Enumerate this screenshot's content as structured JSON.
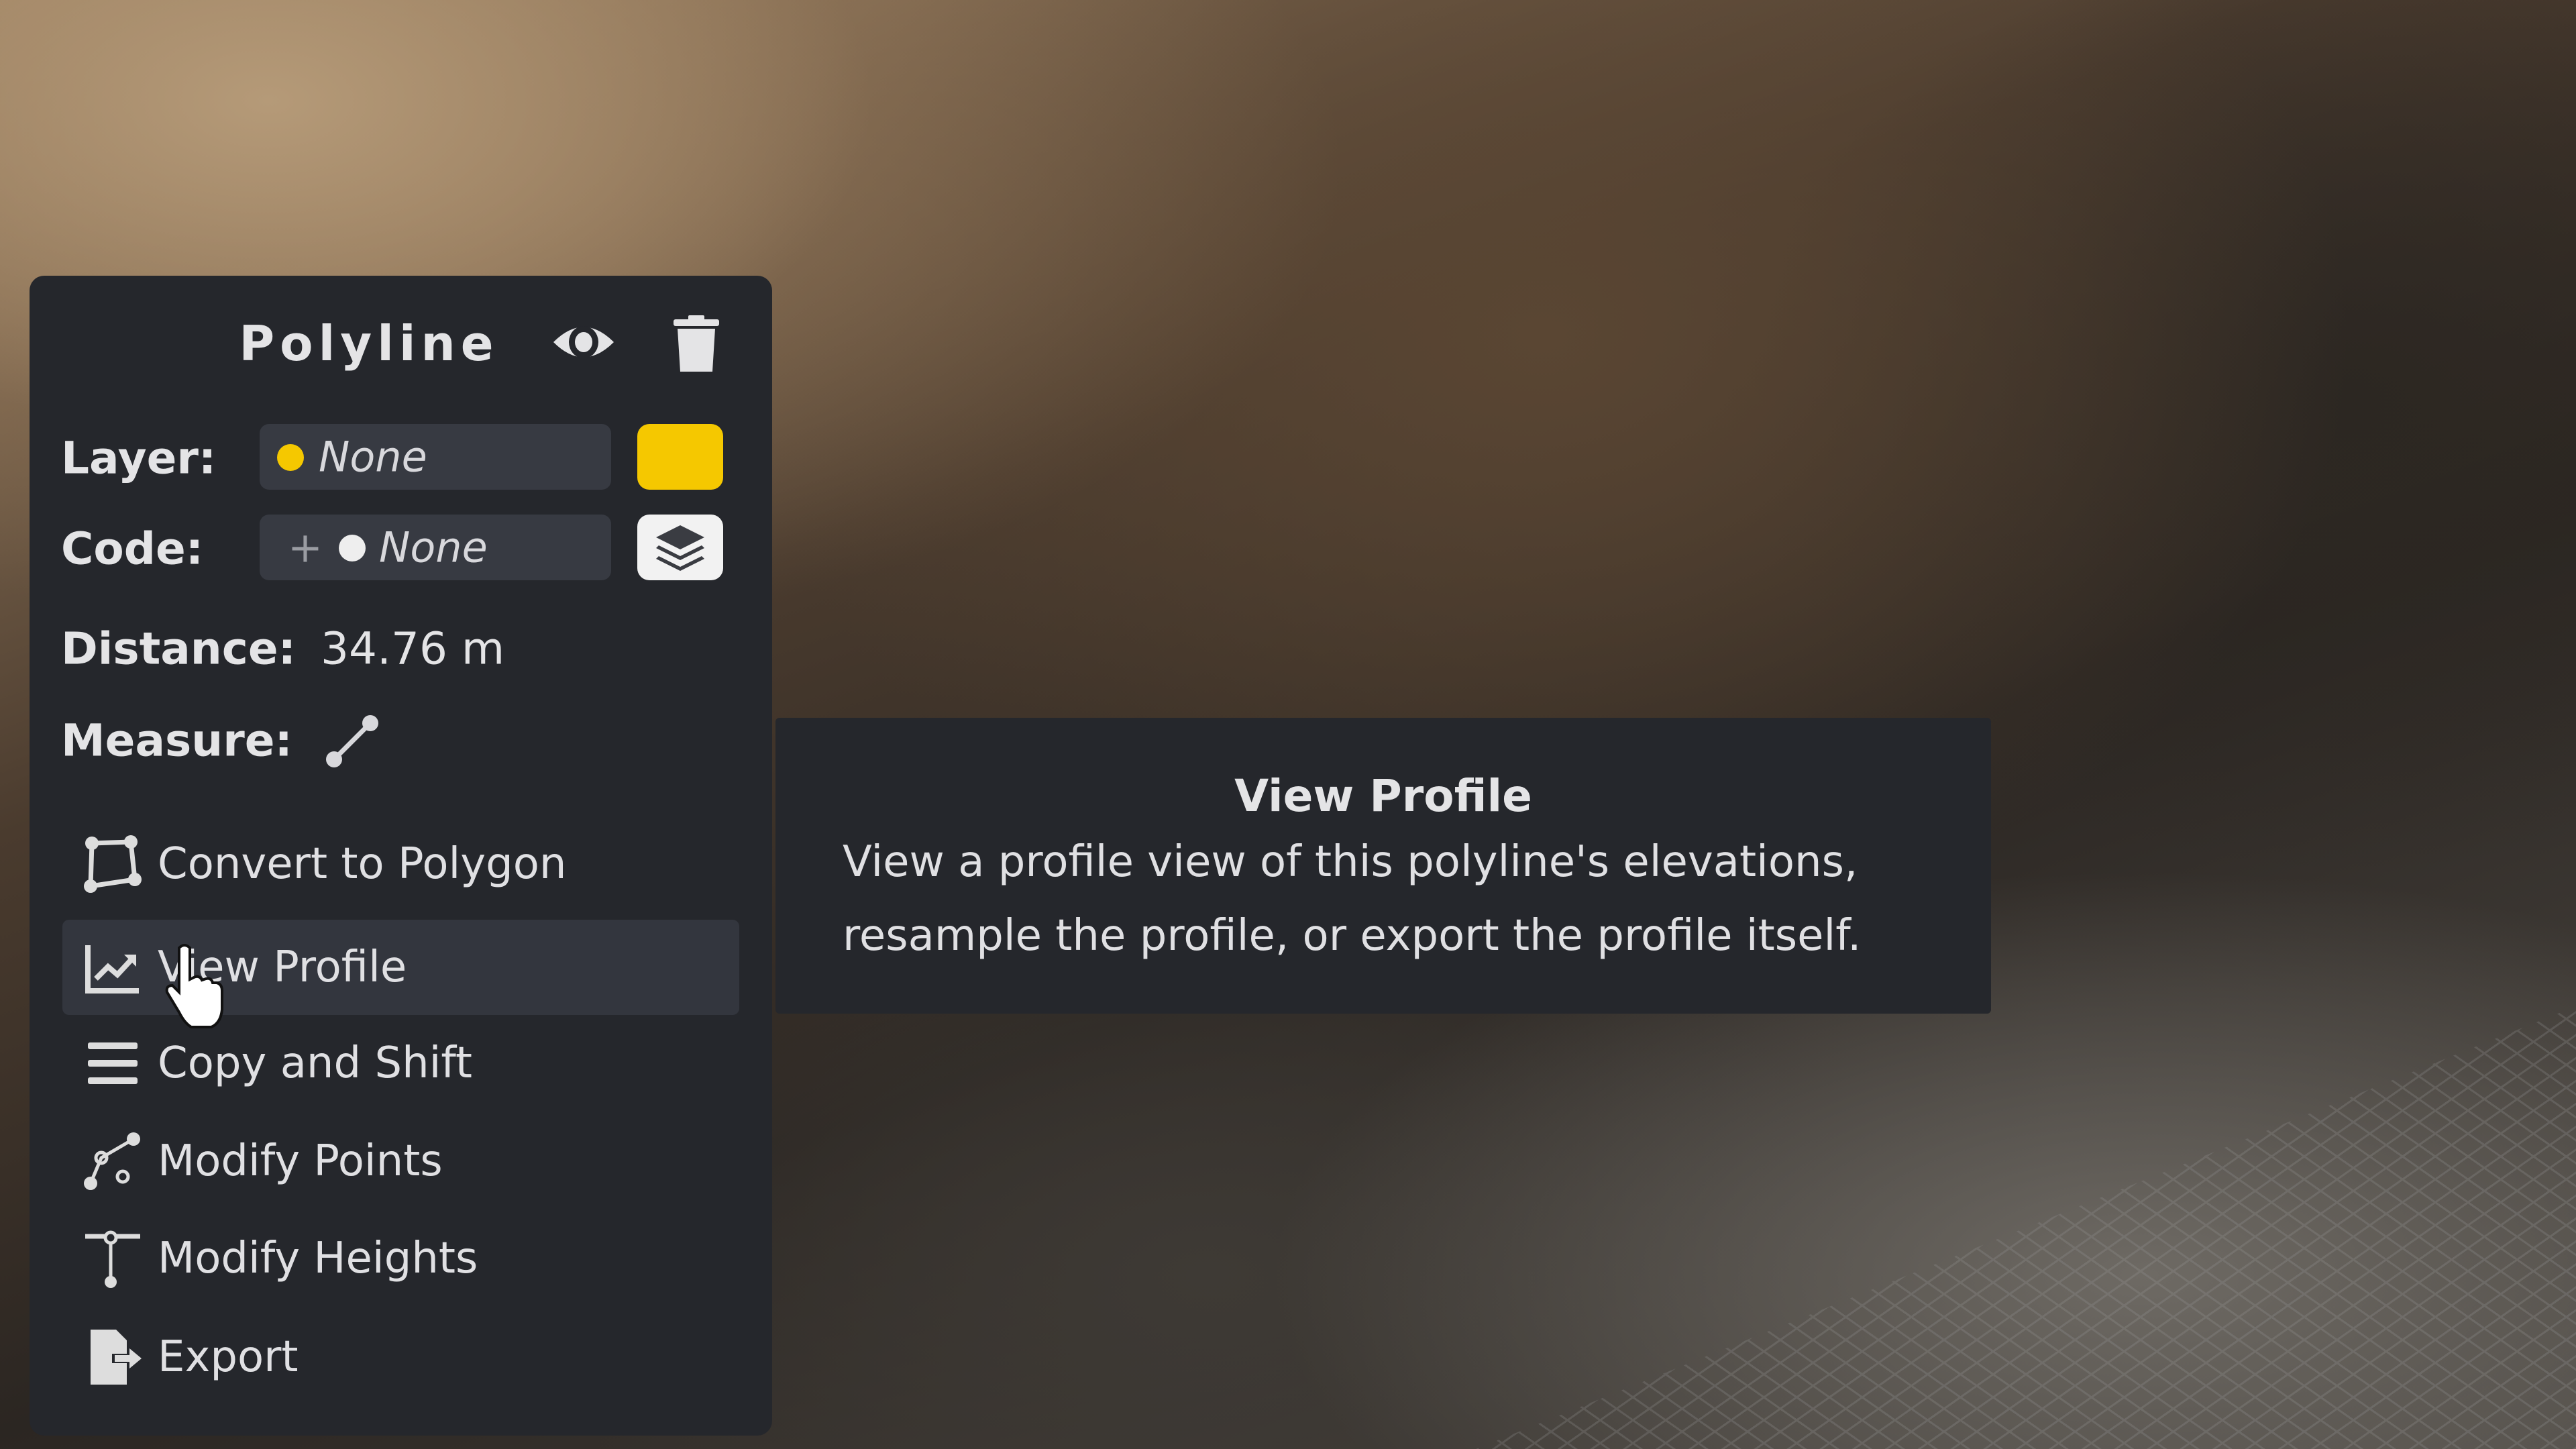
{
  "panel": {
    "title": "Polyline",
    "layer_label": "Layer:",
    "layer_value": "None",
    "layer_color": "#f5c800",
    "code_label": "Code:",
    "code_add": "+",
    "code_value": "None",
    "distance_label": "Distance:",
    "distance_value": "34.76 m",
    "measure_label": "Measure:",
    "actions": [
      {
        "label": "Convert to Polygon",
        "icon": "polygon-icon"
      },
      {
        "label": "View Profile",
        "icon": "chart-line-icon"
      },
      {
        "label": "Copy and Shift",
        "icon": "bars-icon"
      },
      {
        "label": "Modify Points",
        "icon": "nodes-icon"
      },
      {
        "label": "Modify Heights",
        "icon": "height-icon"
      },
      {
        "label": "Export",
        "icon": "file-export-icon"
      }
    ]
  },
  "tooltip": {
    "title": "View Profile",
    "line1": "View a profile view of this polyline's elevations,",
    "line2": "resample the profile, or export the profile itself."
  }
}
